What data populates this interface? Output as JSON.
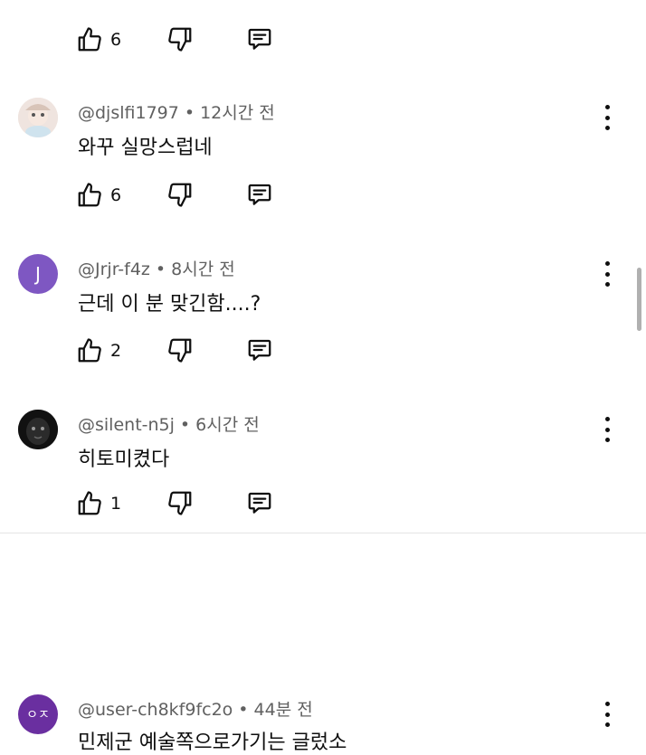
{
  "icons": {
    "like": "thumbs-up-icon",
    "dislike": "thumbs-down-icon",
    "reply": "comment-icon",
    "more": "kebab-icon"
  },
  "colors": {
    "text": "#0f0f0f",
    "meta": "#606060",
    "avatar_j": "#7e57c2",
    "avatar_user": "#6a2fa0"
  },
  "top_actions": {
    "likes": "6"
  },
  "comments": [
    {
      "handle": "@djslfi1797",
      "time": "12시간 전",
      "text": "와꾸 실망스럽네",
      "likes": "6",
      "avatar_text": ""
    },
    {
      "handle": "@Jrjr-f4z",
      "time": "8시간 전",
      "text": "근데 이 분 맞긴함....?",
      "likes": "2",
      "avatar_text": "J"
    },
    {
      "handle": "@silent-n5j",
      "time": "6시간 전",
      "text": "히토미켰다",
      "likes": "1",
      "avatar_text": ""
    },
    {
      "handle": "@user-ch8kf9fc2o",
      "time": "44분 전",
      "text": "민제군 예술쪽으로가기는 글렀소",
      "avatar_text": "ㅇㅈ"
    }
  ]
}
